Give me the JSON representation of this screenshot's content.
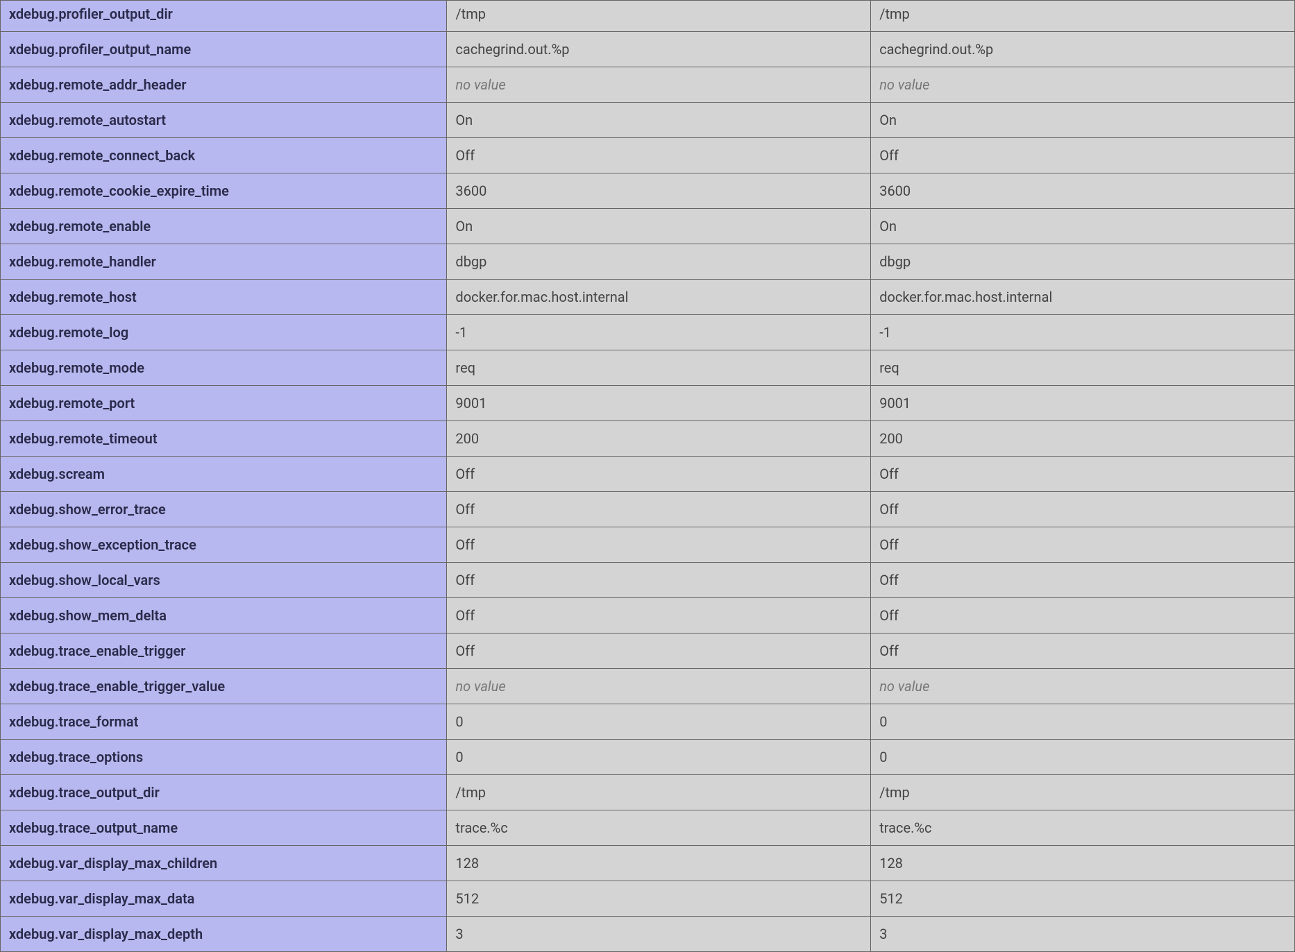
{
  "no_value_text": "no value",
  "rows": [
    {
      "directive": "xdebug.profiler_output_dir",
      "local": "/tmp",
      "master": "/tmp",
      "local_empty": false,
      "master_empty": false,
      "top": true
    },
    {
      "directive": "xdebug.profiler_output_name",
      "local": "cachegrind.out.%p",
      "master": "cachegrind.out.%p",
      "local_empty": false,
      "master_empty": false
    },
    {
      "directive": "xdebug.remote_addr_header",
      "local": "",
      "master": "",
      "local_empty": true,
      "master_empty": true
    },
    {
      "directive": "xdebug.remote_autostart",
      "local": "On",
      "master": "On",
      "local_empty": false,
      "master_empty": false
    },
    {
      "directive": "xdebug.remote_connect_back",
      "local": "Off",
      "master": "Off",
      "local_empty": false,
      "master_empty": false
    },
    {
      "directive": "xdebug.remote_cookie_expire_time",
      "local": "3600",
      "master": "3600",
      "local_empty": false,
      "master_empty": false
    },
    {
      "directive": "xdebug.remote_enable",
      "local": "On",
      "master": "On",
      "local_empty": false,
      "master_empty": false
    },
    {
      "directive": "xdebug.remote_handler",
      "local": "dbgp",
      "master": "dbgp",
      "local_empty": false,
      "master_empty": false
    },
    {
      "directive": "xdebug.remote_host",
      "local": "docker.for.mac.host.internal",
      "master": "docker.for.mac.host.internal",
      "local_empty": false,
      "master_empty": false
    },
    {
      "directive": "xdebug.remote_log",
      "local": "-1",
      "master": "-1",
      "local_empty": false,
      "master_empty": false
    },
    {
      "directive": "xdebug.remote_mode",
      "local": "req",
      "master": "req",
      "local_empty": false,
      "master_empty": false
    },
    {
      "directive": "xdebug.remote_port",
      "local": "9001",
      "master": "9001",
      "local_empty": false,
      "master_empty": false
    },
    {
      "directive": "xdebug.remote_timeout",
      "local": "200",
      "master": "200",
      "local_empty": false,
      "master_empty": false
    },
    {
      "directive": "xdebug.scream",
      "local": "Off",
      "master": "Off",
      "local_empty": false,
      "master_empty": false
    },
    {
      "directive": "xdebug.show_error_trace",
      "local": "Off",
      "master": "Off",
      "local_empty": false,
      "master_empty": false
    },
    {
      "directive": "xdebug.show_exception_trace",
      "local": "Off",
      "master": "Off",
      "local_empty": false,
      "master_empty": false
    },
    {
      "directive": "xdebug.show_local_vars",
      "local": "Off",
      "master": "Off",
      "local_empty": false,
      "master_empty": false
    },
    {
      "directive": "xdebug.show_mem_delta",
      "local": "Off",
      "master": "Off",
      "local_empty": false,
      "master_empty": false
    },
    {
      "directive": "xdebug.trace_enable_trigger",
      "local": "Off",
      "master": "Off",
      "local_empty": false,
      "master_empty": false
    },
    {
      "directive": "xdebug.trace_enable_trigger_value",
      "local": "",
      "master": "",
      "local_empty": true,
      "master_empty": true
    },
    {
      "directive": "xdebug.trace_format",
      "local": "0",
      "master": "0",
      "local_empty": false,
      "master_empty": false
    },
    {
      "directive": "xdebug.trace_options",
      "local": "0",
      "master": "0",
      "local_empty": false,
      "master_empty": false
    },
    {
      "directive": "xdebug.trace_output_dir",
      "local": "/tmp",
      "master": "/tmp",
      "local_empty": false,
      "master_empty": false
    },
    {
      "directive": "xdebug.trace_output_name",
      "local": "trace.%c",
      "master": "trace.%c",
      "local_empty": false,
      "master_empty": false
    },
    {
      "directive": "xdebug.var_display_max_children",
      "local": "128",
      "master": "128",
      "local_empty": false,
      "master_empty": false
    },
    {
      "directive": "xdebug.var_display_max_data",
      "local": "512",
      "master": "512",
      "local_empty": false,
      "master_empty": false
    },
    {
      "directive": "xdebug.var_display_max_depth",
      "local": "3",
      "master": "3",
      "local_empty": false,
      "master_empty": false
    }
  ]
}
